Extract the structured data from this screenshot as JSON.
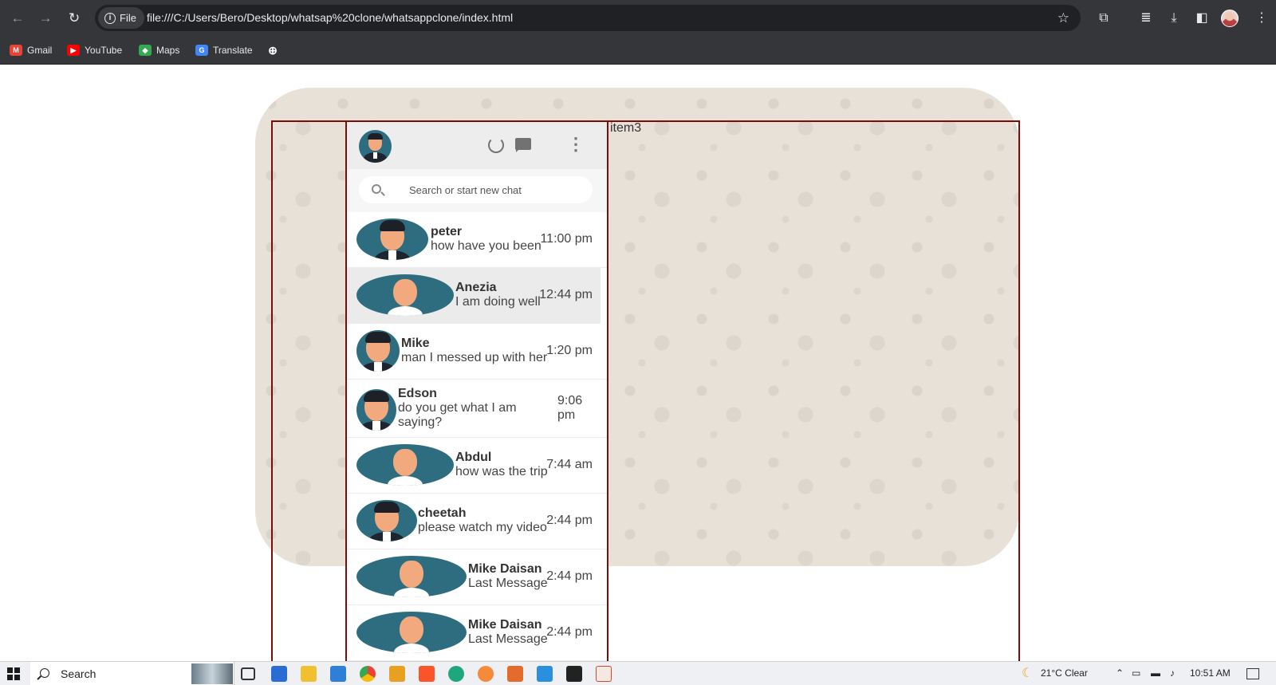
{
  "browser": {
    "url_chip": "File",
    "url": "file:///C:/Users/Bero/Desktop/whatsap%20clone/whatsappclone/index.html",
    "bookmarks": [
      {
        "label": "Gmail",
        "icon": "gmail-icon",
        "color": "#ea4335"
      },
      {
        "label": "YouTube",
        "icon": "youtube-icon",
        "color": "#ff0000"
      },
      {
        "label": "Maps",
        "icon": "maps-icon",
        "color": "#34a853"
      },
      {
        "label": "Translate",
        "icon": "translate-icon",
        "color": "#4285f4"
      }
    ]
  },
  "page": {
    "grid_label": "item3",
    "search_placeholder": "Search or start new chat",
    "chats": [
      {
        "name": "peter",
        "message": "how have you been",
        "time": "11:00 pm",
        "avatar": "man-suit"
      },
      {
        "name": "Anezia",
        "message": "I am doing well",
        "time": "12:44 pm",
        "avatar": "bald-man"
      },
      {
        "name": "Mike",
        "message": "man I messed up with her",
        "time": "1:20 pm",
        "avatar": "man-suit"
      },
      {
        "name": "Edson",
        "message": "do you get what I am saying?",
        "time": "9:06 pm",
        "avatar": "man-suit"
      },
      {
        "name": "Abdul",
        "message": "how was the trip",
        "time": "7:44 am",
        "avatar": "bald-man"
      },
      {
        "name": "cheetah",
        "message": "please watch my video",
        "time": "2:44 pm",
        "avatar": "man-suit"
      },
      {
        "name": "Mike Daisan",
        "message": "Last Message",
        "time": "2:44 pm",
        "avatar": "bald-man"
      },
      {
        "name": "Mike Daisan",
        "message": "Last Message",
        "time": "2:44 pm",
        "avatar": "bald-man"
      }
    ]
  },
  "taskbar": {
    "search_label": "Search",
    "weather": "21°C  Clear",
    "clock": "10:51 AM"
  },
  "colors": {
    "chrome_bg": "#35363a",
    "grid_border": "#7a0c0c",
    "avatar_bg": "#2e6d80",
    "wallpaper": "#e7e1d8"
  }
}
